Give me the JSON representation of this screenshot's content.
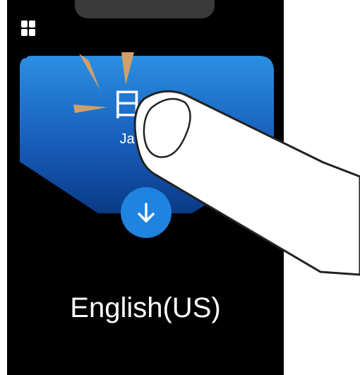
{
  "screen": {
    "source_language": {
      "glyph": "日",
      "label": "Ja"
    },
    "target_language": {
      "label": "English(US)"
    },
    "icons": {
      "menu": "grid-menu-icon",
      "swap": "arrow-down-icon",
      "tap_gesture": "finger-tap-icon"
    }
  },
  "colors": {
    "device_bg": "#000000",
    "card_top": "#2b8fe3",
    "card_bottom": "#0b3a86",
    "button": "#1f83e0",
    "tap_rays": "#d1a06a"
  }
}
